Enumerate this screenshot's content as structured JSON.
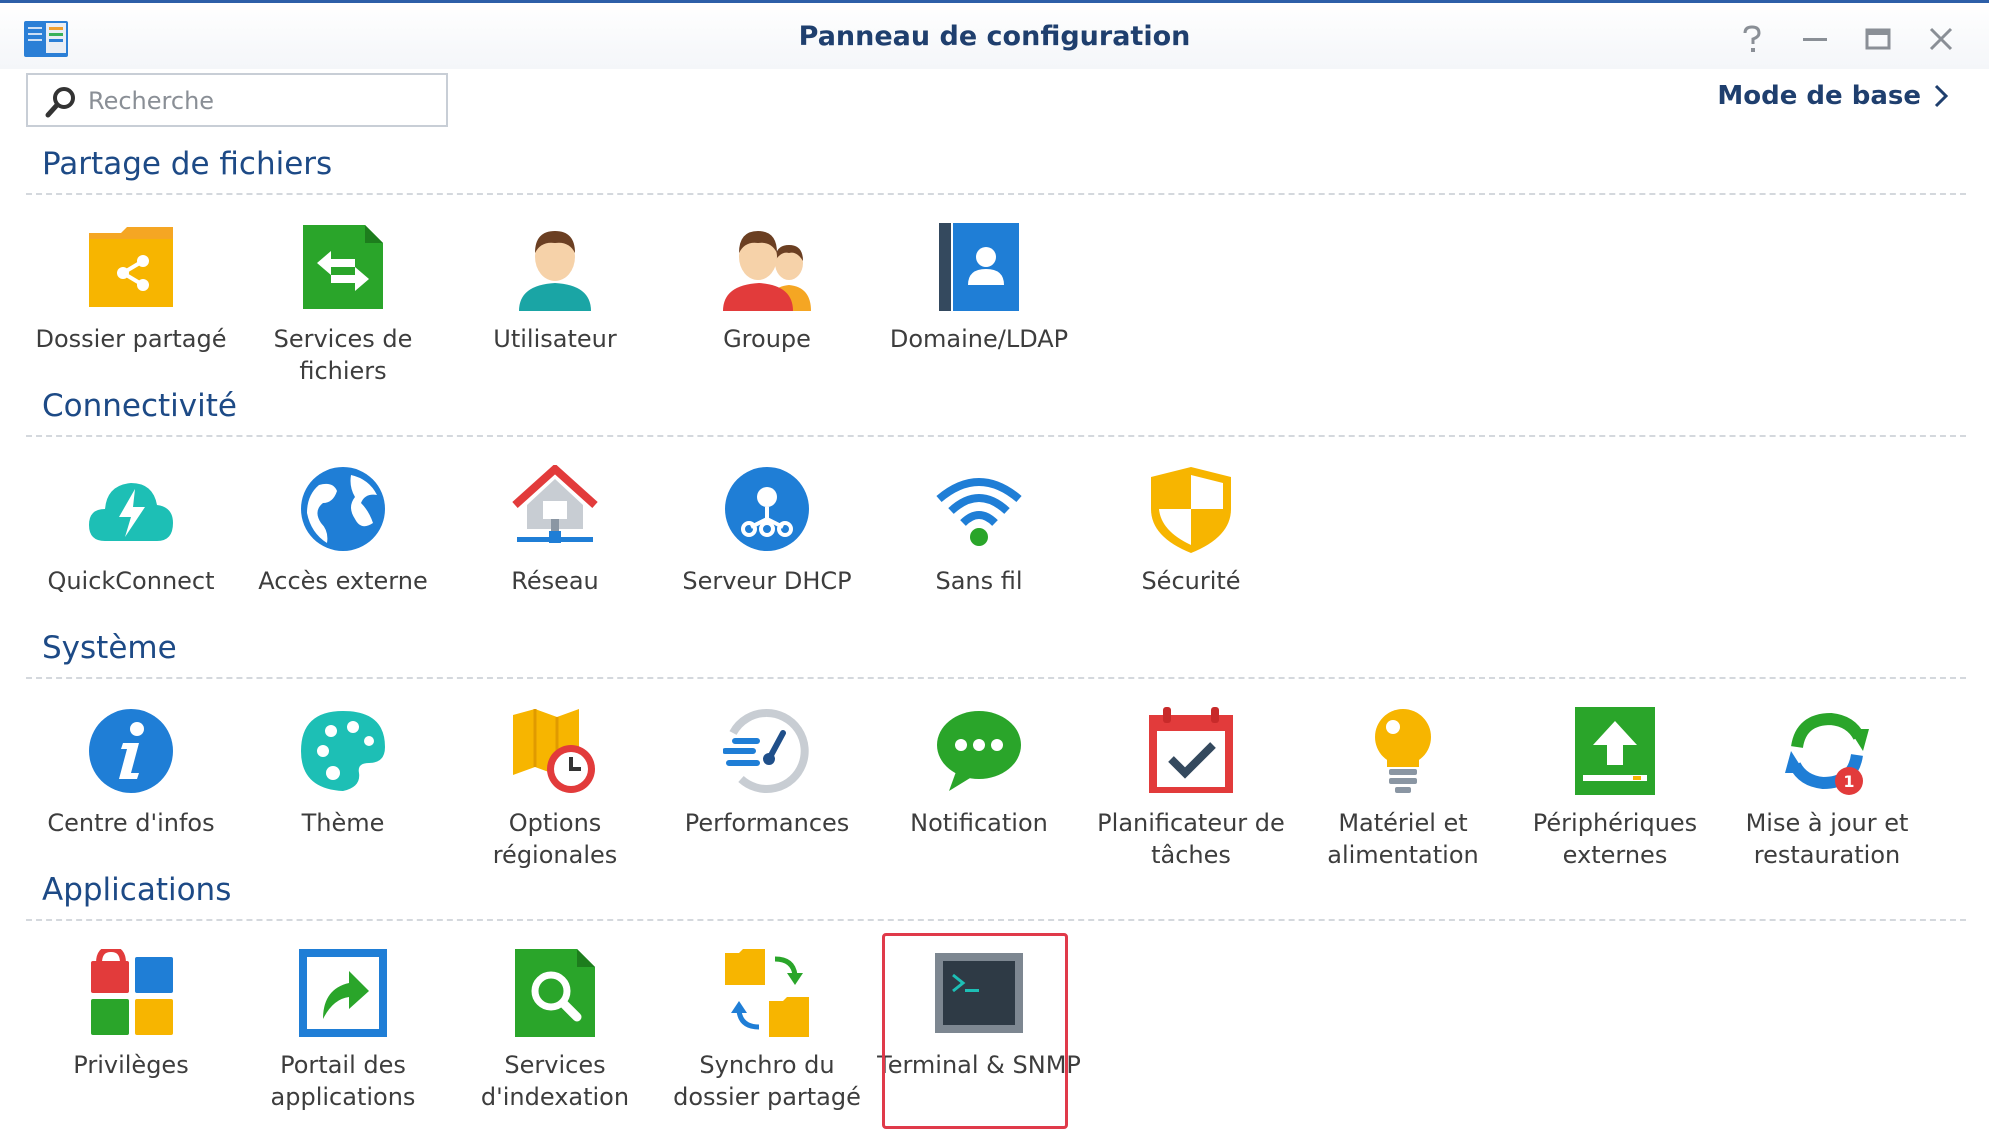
{
  "window": {
    "title": "Panneau de configuration",
    "icon": "control-panel-icon",
    "controls": [
      "help-icon",
      "minimize-icon",
      "maximize-icon",
      "close-icon"
    ]
  },
  "toolbar": {
    "search_placeholder": "Recherche",
    "mode_label": "Mode de base"
  },
  "colors": {
    "title": "#1f3f6e",
    "section": "#1d4a86",
    "highlight": "#e03a4a"
  },
  "sections": [
    {
      "title": "Partage de fichiers",
      "items": [
        {
          "label": "Dossier partagé",
          "icon": "shared-folder-icon"
        },
        {
          "label": "Services de fichiers",
          "icon": "file-services-icon"
        },
        {
          "label": "Utilisateur",
          "icon": "user-icon"
        },
        {
          "label": "Groupe",
          "icon": "group-icon"
        },
        {
          "label": "Domaine/LDAP",
          "icon": "domain-ldap-icon"
        }
      ]
    },
    {
      "title": "Connectivité",
      "items": [
        {
          "label": "QuickConnect",
          "icon": "quickconnect-icon"
        },
        {
          "label": "Accès externe",
          "icon": "external-access-icon"
        },
        {
          "label": "Réseau",
          "icon": "network-icon"
        },
        {
          "label": "Serveur DHCP",
          "icon": "dhcp-server-icon"
        },
        {
          "label": "Sans fil",
          "icon": "wireless-icon"
        },
        {
          "label": "Sécurité",
          "icon": "security-icon"
        }
      ]
    },
    {
      "title": "Système",
      "items": [
        {
          "label": "Centre d'infos",
          "icon": "info-center-icon"
        },
        {
          "label": "Thème",
          "icon": "theme-icon"
        },
        {
          "label": "Options régionales",
          "icon": "regional-options-icon"
        },
        {
          "label": "Performances",
          "icon": "performance-icon"
        },
        {
          "label": "Notification",
          "icon": "notification-icon"
        },
        {
          "label": "Planificateur de tâches",
          "icon": "task-scheduler-icon"
        },
        {
          "label": "Matériel et alimentation",
          "icon": "hardware-power-icon"
        },
        {
          "label": "Périphériques externes",
          "icon": "external-devices-icon"
        },
        {
          "label": "Mise à jour et restauration",
          "icon": "update-restore-icon",
          "badge": "1"
        }
      ]
    },
    {
      "title": "Applications",
      "items": [
        {
          "label": "Privilèges",
          "icon": "privileges-icon"
        },
        {
          "label": "Portail des applications",
          "icon": "application-portal-icon"
        },
        {
          "label": "Services d'indexation",
          "icon": "indexing-service-icon"
        },
        {
          "label": "Synchro du dossier partagé",
          "icon": "shared-folder-sync-icon"
        },
        {
          "label": "Terminal & SNMP",
          "icon": "terminal-snmp-icon",
          "highlighted": true
        }
      ]
    }
  ]
}
